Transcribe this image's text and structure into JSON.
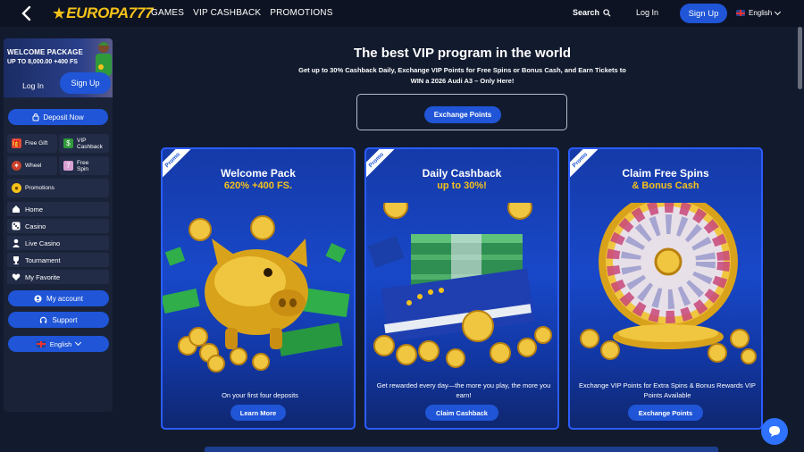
{
  "header": {
    "logo": "EUROPA777",
    "nav": [
      "GAMES",
      "VIP CASHBACK",
      "PROMOTIONS"
    ],
    "search_label": "Search",
    "login_label": "Log In",
    "signup_label": "Sign Up",
    "language": "English"
  },
  "sidebar": {
    "welcome_title": "WELCOME PACKAGE",
    "welcome_sub": "UP TO 8,000.00 +400 FS",
    "login_label": "Log In",
    "signup_label": "Sign Up",
    "deposit_label": "Deposit Now",
    "tiles": [
      {
        "label": "Free Gift",
        "icon": "gift-icon"
      },
      {
        "label": "VIP Cashback",
        "icon": "cashback-icon"
      },
      {
        "label": "Wheel",
        "icon": "wheel-icon"
      },
      {
        "label": "Free Spin",
        "icon": "slot-icon"
      },
      {
        "label": "Promotions",
        "icon": "coin-icon"
      }
    ],
    "menu": [
      {
        "label": "Home",
        "icon": "home-icon"
      },
      {
        "label": "Casino",
        "icon": "dice-icon"
      },
      {
        "label": "Live Casino",
        "icon": "live-icon"
      },
      {
        "label": "Tournament",
        "icon": "trophy-icon"
      },
      {
        "label": "My Favorite",
        "icon": "heart-icon"
      }
    ],
    "account_label": "My account",
    "support_label": "Support",
    "language": "English"
  },
  "main": {
    "title": "The best VIP program in the world",
    "subtitle_line1": "Get up to 30% Cashback Daily, Exchange VIP Points for Free Spins or Bonus Cash, and Earn Tickets to",
    "subtitle_line2": "WIN a 2026 Audi A3 – Only Here!",
    "exchange_label": "Exchange Points"
  },
  "cards": [
    {
      "badge": "Promo",
      "title": "Welcome Pack",
      "subtitle": "620% +400 FS.",
      "desc": "On your first four deposits",
      "button": "Learn More"
    },
    {
      "badge": "Promo",
      "title": "Daily Cashback",
      "subtitle": "up to 30%!",
      "desc": "Get rewarded every day—the more you play, the more you earn!",
      "button": "Claim Cashback"
    },
    {
      "badge": "Promo",
      "title": "Claim Free Spins",
      "subtitle": "& Bonus Cash",
      "desc": "Exchange VIP Points for Extra Spins & Bonus Rewards VIP Points Available",
      "button": "Exchange Points"
    }
  ],
  "colors": {
    "accent": "#1f55d6",
    "gold": "#f6c21a",
    "bg": "#121a2e",
    "card_border": "#2b5dff"
  }
}
